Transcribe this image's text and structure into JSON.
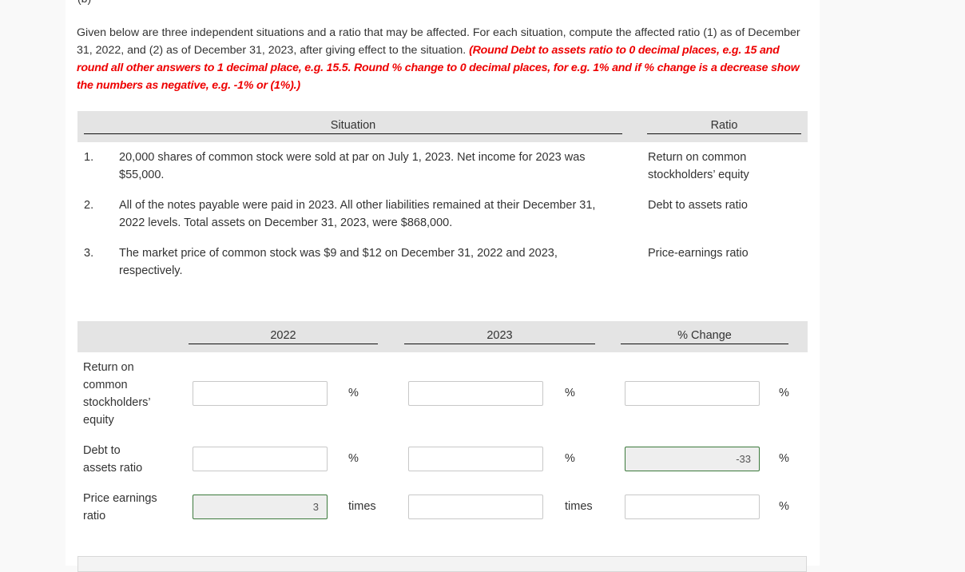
{
  "part_label": "(b)",
  "intro": {
    "text": "Given below are three independent situations and a ratio that may be affected. For each situation, compute the affected ratio (1) as of December 31, 2022, and (2) as of December 31, 2023, after giving effect to the situation. ",
    "instruction": "(Round Debt to assets ratio to 0 decimal places, e.g. 15 and round all other answers to 1 decimal place, e.g. 15.5. Round % change to 0 decimal places, for e.g. 1% and if % change is a decrease show the numbers as negative, e.g. -1% or (1%).)"
  },
  "situation_table": {
    "headers": {
      "situation": "Situation",
      "ratio": "Ratio"
    },
    "rows": [
      {
        "num": "1.",
        "text": "20,000 shares of common stock were sold at par on July 1, 2023. Net income for 2023 was $55,000.",
        "ratio": "Return on common stockholders’ equity"
      },
      {
        "num": "2.",
        "text": "All of the notes payable were paid in 2023. All other liabilities remained at their December 31, 2022 levels. Total assets on December 31, 2023, were $868,000.",
        "ratio": "Debt to assets ratio"
      },
      {
        "num": "3.",
        "text": "The market price of common stock was $9 and $12 on December 31, 2022 and 2023, respectively.",
        "ratio": "Price-earnings ratio"
      }
    ]
  },
  "answer_table": {
    "headers": {
      "y2022": "2022",
      "y2023": "2023",
      "change": "% Change"
    },
    "rows": [
      {
        "label": "Return on common stockholders’ equity",
        "v2022": "",
        "u2022": "%",
        "v2023": "",
        "u2023": "%",
        "change": "",
        "uchange": "%"
      },
      {
        "label": "Debt to assets ratio",
        "v2022": "",
        "u2022": "%",
        "v2023": "",
        "u2023": "%",
        "change": "-33",
        "uchange": "%"
      },
      {
        "label": "Price earnings ratio",
        "v2022": "3",
        "u2022": "times",
        "v2023": "",
        "u2023": "times",
        "change": "",
        "uchange": "%"
      }
    ]
  },
  "colors": {
    "instruction_red": "#ee0000",
    "filled_border": "#3c7a3c",
    "header_bg": "#e4e4e4"
  }
}
